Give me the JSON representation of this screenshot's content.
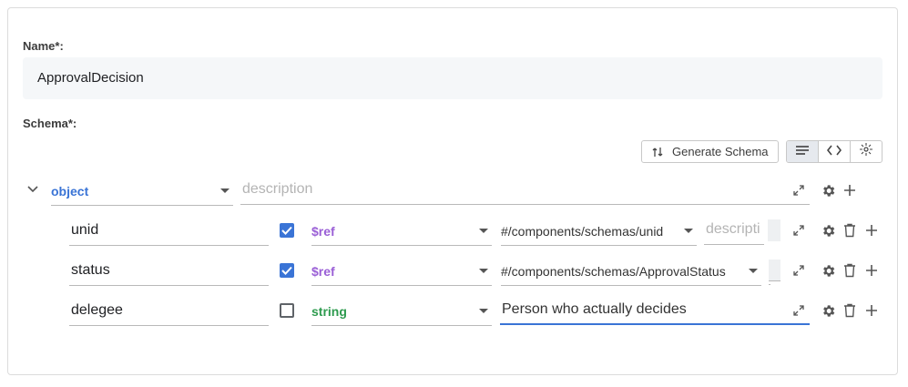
{
  "name": {
    "label": "Name*:",
    "value": "ApprovalDecision"
  },
  "schema": {
    "label": "Schema*:",
    "generate_label": "Generate Schema",
    "view_modes": [
      "list-view",
      "code-view",
      "visual-view"
    ],
    "root": {
      "type": "object",
      "description_placeholder": "description"
    },
    "rows": [
      {
        "name": "unid",
        "required": true,
        "type": "$ref",
        "ref": "#/components/schemas/unid",
        "description": "",
        "description_placeholder": "descripti"
      },
      {
        "name": "status",
        "required": true,
        "type": "$ref",
        "ref": "#/components/schemas/ApprovalStatus",
        "description": "",
        "description_placeholder": ""
      },
      {
        "name": "delegee",
        "required": false,
        "type": "string",
        "description": "Person who actually decides",
        "description_placeholder": ""
      }
    ]
  },
  "colors": {
    "accent": "#3a74d6",
    "type_ref": "#9a5fd6",
    "type_string": "#2e9b4f",
    "type_object": "#3a74d6"
  }
}
